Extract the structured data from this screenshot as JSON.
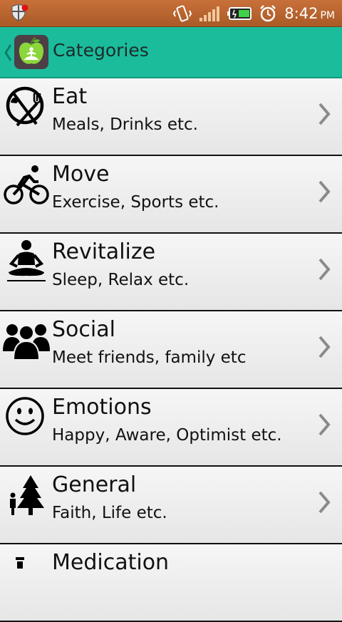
{
  "status_bar": {
    "time": "8:42",
    "ampm": "PM",
    "icons": [
      "shield-notification-icon",
      "vibrate-icon",
      "signal-icon",
      "battery-icon",
      "alarm-icon"
    ]
  },
  "action_bar": {
    "title": "Categories",
    "accent": "#1abc9c",
    "icon": "app-apple-meditation-logo"
  },
  "categories": [
    {
      "title": "Eat",
      "subtitle": "Meals, Drinks etc.",
      "icon": "plate-fork-knife-icon"
    },
    {
      "title": "Move",
      "subtitle": "Exercise, Sports etc.",
      "icon": "cyclist-icon"
    },
    {
      "title": "Revitalize",
      "subtitle": "Sleep, Relax etc.",
      "icon": "meditation-icon"
    },
    {
      "title": "Social",
      "subtitle": "Meet friends, family etc",
      "icon": "group-icon"
    },
    {
      "title": "Emotions",
      "subtitle": "Happy, Aware, Optimist etc.",
      "icon": "smiley-icon"
    },
    {
      "title": "General",
      "subtitle": "Faith, Life etc.",
      "icon": "person-tree-icon"
    },
    {
      "title": "Medication",
      "subtitle": "",
      "icon": "pill-icon"
    }
  ]
}
